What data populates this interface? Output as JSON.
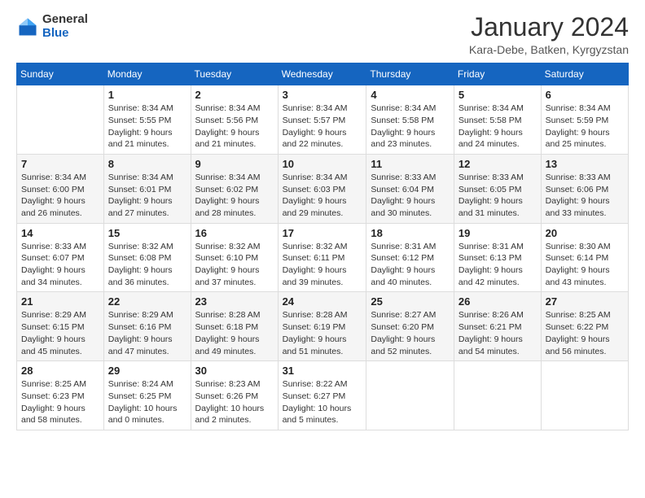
{
  "logo": {
    "general": "General",
    "blue": "Blue"
  },
  "title": {
    "main": "January 2024",
    "sub": "Kara-Debe, Batken, Kyrgyzstan"
  },
  "days_of_week": [
    "Sunday",
    "Monday",
    "Tuesday",
    "Wednesday",
    "Thursday",
    "Friday",
    "Saturday"
  ],
  "weeks": [
    [
      {
        "day": "",
        "sunrise": "",
        "sunset": "",
        "daylight": ""
      },
      {
        "day": "1",
        "sunrise": "Sunrise: 8:34 AM",
        "sunset": "Sunset: 5:55 PM",
        "daylight": "Daylight: 9 hours and 21 minutes."
      },
      {
        "day": "2",
        "sunrise": "Sunrise: 8:34 AM",
        "sunset": "Sunset: 5:56 PM",
        "daylight": "Daylight: 9 hours and 21 minutes."
      },
      {
        "day": "3",
        "sunrise": "Sunrise: 8:34 AM",
        "sunset": "Sunset: 5:57 PM",
        "daylight": "Daylight: 9 hours and 22 minutes."
      },
      {
        "day": "4",
        "sunrise": "Sunrise: 8:34 AM",
        "sunset": "Sunset: 5:58 PM",
        "daylight": "Daylight: 9 hours and 23 minutes."
      },
      {
        "day": "5",
        "sunrise": "Sunrise: 8:34 AM",
        "sunset": "Sunset: 5:58 PM",
        "daylight": "Daylight: 9 hours and 24 minutes."
      },
      {
        "day": "6",
        "sunrise": "Sunrise: 8:34 AM",
        "sunset": "Sunset: 5:59 PM",
        "daylight": "Daylight: 9 hours and 25 minutes."
      }
    ],
    [
      {
        "day": "7",
        "sunrise": "Sunrise: 8:34 AM",
        "sunset": "Sunset: 6:00 PM",
        "daylight": "Daylight: 9 hours and 26 minutes."
      },
      {
        "day": "8",
        "sunrise": "Sunrise: 8:34 AM",
        "sunset": "Sunset: 6:01 PM",
        "daylight": "Daylight: 9 hours and 27 minutes."
      },
      {
        "day": "9",
        "sunrise": "Sunrise: 8:34 AM",
        "sunset": "Sunset: 6:02 PM",
        "daylight": "Daylight: 9 hours and 28 minutes."
      },
      {
        "day": "10",
        "sunrise": "Sunrise: 8:34 AM",
        "sunset": "Sunset: 6:03 PM",
        "daylight": "Daylight: 9 hours and 29 minutes."
      },
      {
        "day": "11",
        "sunrise": "Sunrise: 8:33 AM",
        "sunset": "Sunset: 6:04 PM",
        "daylight": "Daylight: 9 hours and 30 minutes."
      },
      {
        "day": "12",
        "sunrise": "Sunrise: 8:33 AM",
        "sunset": "Sunset: 6:05 PM",
        "daylight": "Daylight: 9 hours and 31 minutes."
      },
      {
        "day": "13",
        "sunrise": "Sunrise: 8:33 AM",
        "sunset": "Sunset: 6:06 PM",
        "daylight": "Daylight: 9 hours and 33 minutes."
      }
    ],
    [
      {
        "day": "14",
        "sunrise": "Sunrise: 8:33 AM",
        "sunset": "Sunset: 6:07 PM",
        "daylight": "Daylight: 9 hours and 34 minutes."
      },
      {
        "day": "15",
        "sunrise": "Sunrise: 8:32 AM",
        "sunset": "Sunset: 6:08 PM",
        "daylight": "Daylight: 9 hours and 36 minutes."
      },
      {
        "day": "16",
        "sunrise": "Sunrise: 8:32 AM",
        "sunset": "Sunset: 6:10 PM",
        "daylight": "Daylight: 9 hours and 37 minutes."
      },
      {
        "day": "17",
        "sunrise": "Sunrise: 8:32 AM",
        "sunset": "Sunset: 6:11 PM",
        "daylight": "Daylight: 9 hours and 39 minutes."
      },
      {
        "day": "18",
        "sunrise": "Sunrise: 8:31 AM",
        "sunset": "Sunset: 6:12 PM",
        "daylight": "Daylight: 9 hours and 40 minutes."
      },
      {
        "day": "19",
        "sunrise": "Sunrise: 8:31 AM",
        "sunset": "Sunset: 6:13 PM",
        "daylight": "Daylight: 9 hours and 42 minutes."
      },
      {
        "day": "20",
        "sunrise": "Sunrise: 8:30 AM",
        "sunset": "Sunset: 6:14 PM",
        "daylight": "Daylight: 9 hours and 43 minutes."
      }
    ],
    [
      {
        "day": "21",
        "sunrise": "Sunrise: 8:29 AM",
        "sunset": "Sunset: 6:15 PM",
        "daylight": "Daylight: 9 hours and 45 minutes."
      },
      {
        "day": "22",
        "sunrise": "Sunrise: 8:29 AM",
        "sunset": "Sunset: 6:16 PM",
        "daylight": "Daylight: 9 hours and 47 minutes."
      },
      {
        "day": "23",
        "sunrise": "Sunrise: 8:28 AM",
        "sunset": "Sunset: 6:18 PM",
        "daylight": "Daylight: 9 hours and 49 minutes."
      },
      {
        "day": "24",
        "sunrise": "Sunrise: 8:28 AM",
        "sunset": "Sunset: 6:19 PM",
        "daylight": "Daylight: 9 hours and 51 minutes."
      },
      {
        "day": "25",
        "sunrise": "Sunrise: 8:27 AM",
        "sunset": "Sunset: 6:20 PM",
        "daylight": "Daylight: 9 hours and 52 minutes."
      },
      {
        "day": "26",
        "sunrise": "Sunrise: 8:26 AM",
        "sunset": "Sunset: 6:21 PM",
        "daylight": "Daylight: 9 hours and 54 minutes."
      },
      {
        "day": "27",
        "sunrise": "Sunrise: 8:25 AM",
        "sunset": "Sunset: 6:22 PM",
        "daylight": "Daylight: 9 hours and 56 minutes."
      }
    ],
    [
      {
        "day": "28",
        "sunrise": "Sunrise: 8:25 AM",
        "sunset": "Sunset: 6:23 PM",
        "daylight": "Daylight: 9 hours and 58 minutes."
      },
      {
        "day": "29",
        "sunrise": "Sunrise: 8:24 AM",
        "sunset": "Sunset: 6:25 PM",
        "daylight": "Daylight: 10 hours and 0 minutes."
      },
      {
        "day": "30",
        "sunrise": "Sunrise: 8:23 AM",
        "sunset": "Sunset: 6:26 PM",
        "daylight": "Daylight: 10 hours and 2 minutes."
      },
      {
        "day": "31",
        "sunrise": "Sunrise: 8:22 AM",
        "sunset": "Sunset: 6:27 PM",
        "daylight": "Daylight: 10 hours and 5 minutes."
      },
      {
        "day": "",
        "sunrise": "",
        "sunset": "",
        "daylight": ""
      },
      {
        "day": "",
        "sunrise": "",
        "sunset": "",
        "daylight": ""
      },
      {
        "day": "",
        "sunrise": "",
        "sunset": "",
        "daylight": ""
      }
    ]
  ]
}
